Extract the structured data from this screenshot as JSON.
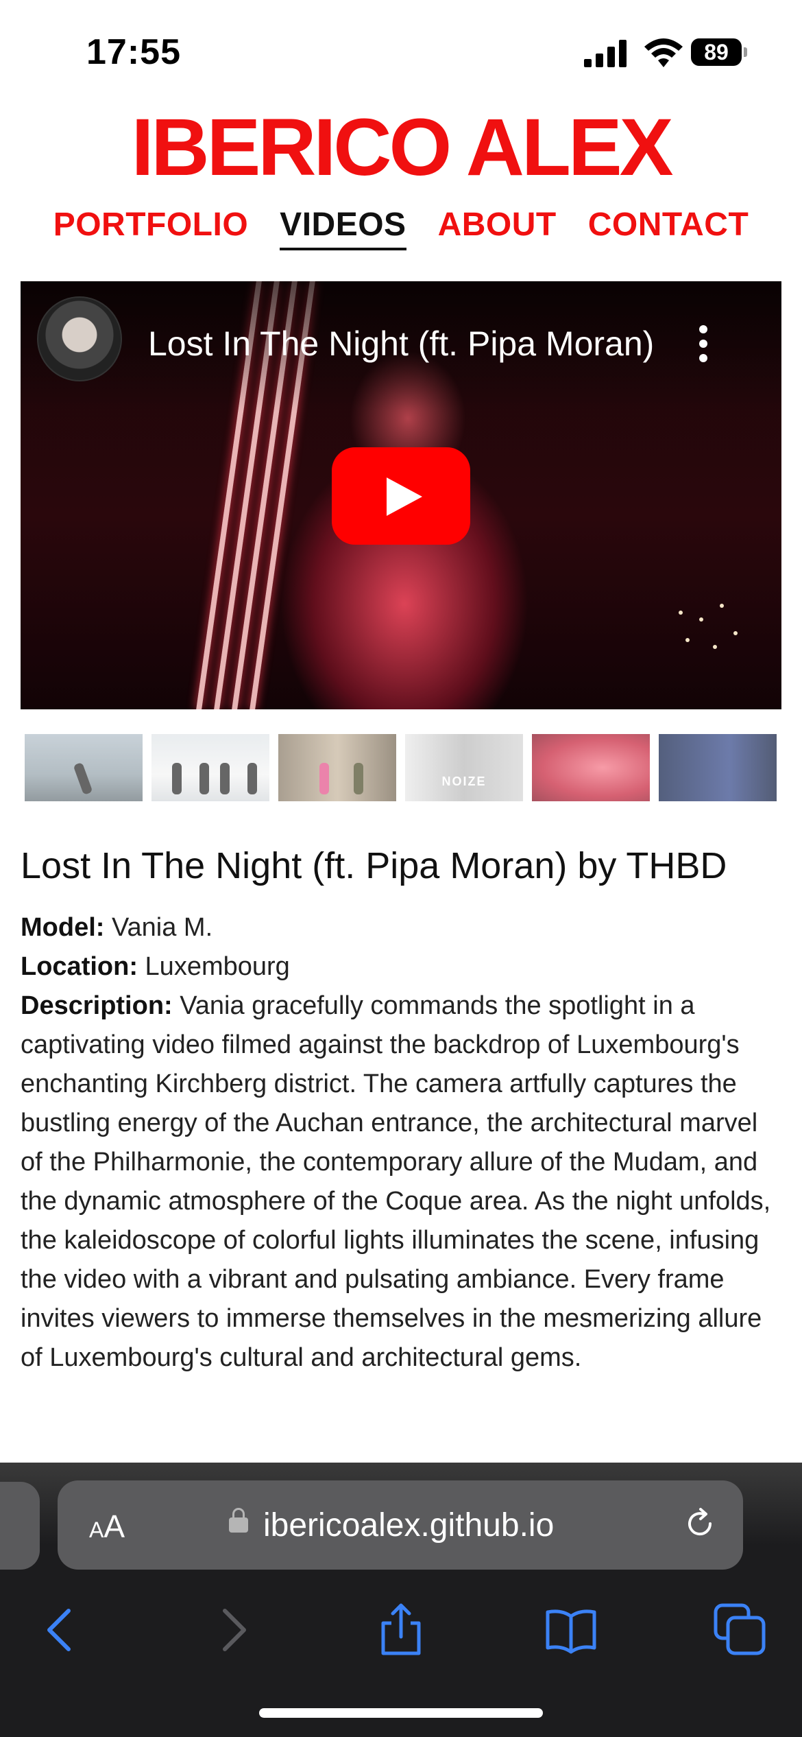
{
  "status": {
    "time": "17:55",
    "battery": "89"
  },
  "site": {
    "brand": "IBERICO ALEX",
    "nav": [
      "PORTFOLIO",
      "VIDEOS",
      "ABOUT",
      "CONTACT"
    ],
    "active_nav": "VIDEOS",
    "brand_color": "#f01010"
  },
  "video": {
    "title": "Lost In The Night (ft. Pipa Moran)",
    "play_color": "#ff0000"
  },
  "thumbnails": [
    {
      "caption": ""
    },
    {
      "caption": ""
    },
    {
      "caption": ""
    },
    {
      "caption": "NOIZE"
    },
    {
      "caption": ""
    },
    {
      "caption": ""
    }
  ],
  "details": {
    "heading": "Lost In The Night (ft. Pipa Moran) by THBD",
    "model_label": "Model:",
    "model": "Vania M.",
    "location_label": "Location:",
    "location": "Luxembourg",
    "description_label": "Description:",
    "description": "Vania gracefully commands the spotlight in a captivating video filmed against the backdrop of Luxembourg's enchanting Kirchberg district. The camera artfully captures the bustling energy of the Auchan entrance, the architectural marvel of the Philharmonie, the contemporary allure of the Mudam, and the dynamic atmosphere of the Coque area. As the night unfolds, the kaleidoscope of colorful lights illuminates the scene, infusing the video with a vibrant and pulsating ambiance. Every frame invites viewers to immerse themselves in the mesmerizing allure of Luxembourg's cultural and architectural gems."
  },
  "browser": {
    "aa_small": "A",
    "aa_large": "A",
    "url": "ibericoalex.github.io",
    "icons": [
      "back-icon",
      "forward-icon",
      "share-icon",
      "bookmarks-icon",
      "tabs-icon"
    ],
    "accent": "#3b82f6"
  }
}
